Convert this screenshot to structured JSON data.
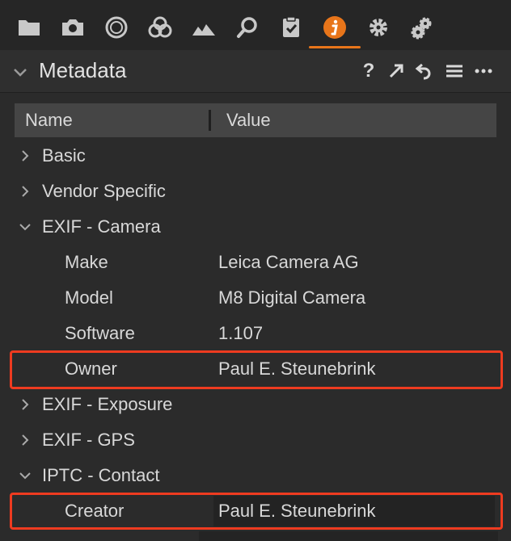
{
  "toolbar": {
    "tabs": [
      {
        "icon": "folder-icon"
      },
      {
        "icon": "camera-icon"
      },
      {
        "icon": "lens-circle-icon"
      },
      {
        "icon": "color-circles-icon"
      },
      {
        "icon": "exposure-mountain-icon"
      },
      {
        "icon": "magnifier-icon"
      },
      {
        "icon": "clipboard-check-icon"
      },
      {
        "icon": "info-icon",
        "active": true
      },
      {
        "icon": "gear-icon"
      },
      {
        "icon": "gears-icon"
      }
    ],
    "accent_color": "#e8751a"
  },
  "panel": {
    "title": "Metadata",
    "help_label": "?",
    "actions": [
      "help-icon",
      "expand-arrow-icon",
      "reset-icon",
      "menu-icon",
      "more-icon"
    ]
  },
  "table": {
    "columns": {
      "name": "Name",
      "value": "Value"
    },
    "rows": [
      {
        "label": "Basic",
        "type": "group",
        "expanded": false
      },
      {
        "label": "Vendor Specific",
        "type": "group",
        "expanded": false
      },
      {
        "label": "EXIF - Camera",
        "type": "group",
        "expanded": true
      },
      {
        "label": "Make",
        "value": "Leica Camera AG",
        "type": "child"
      },
      {
        "label": "Model",
        "value": "M8 Digital Camera",
        "type": "child"
      },
      {
        "label": "Software",
        "value": "1.107",
        "type": "child"
      },
      {
        "label": "Owner",
        "value": "Paul E. Steunebrink",
        "type": "child",
        "highlighted": true
      },
      {
        "label": "EXIF - Exposure",
        "type": "group",
        "expanded": false
      },
      {
        "label": "EXIF - GPS",
        "type": "group",
        "expanded": false
      },
      {
        "label": "IPTC - Contact",
        "type": "group",
        "expanded": true
      },
      {
        "label": "Creator",
        "value": "Paul E. Steunebrink",
        "type": "child",
        "highlighted": true,
        "editable": true
      }
    ]
  },
  "highlight_color": "#ee3b20"
}
